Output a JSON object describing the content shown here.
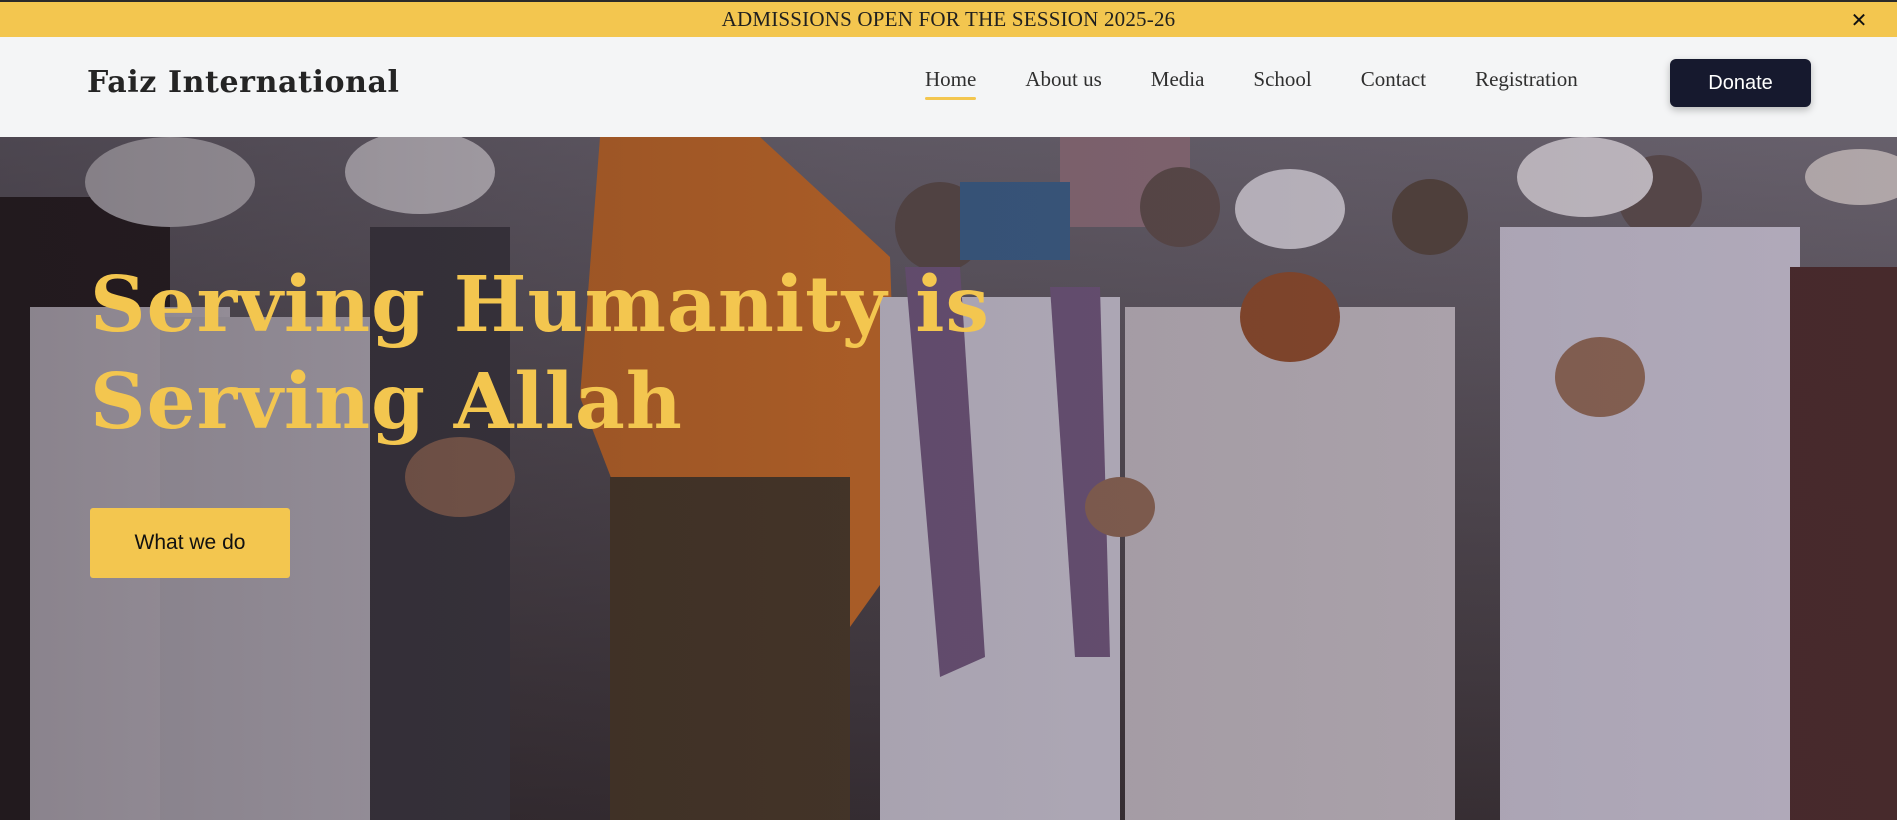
{
  "announcement": {
    "text": "ADMISSIONS OPEN FOR THE SESSION 2025-26",
    "close_icon": "close-icon"
  },
  "header": {
    "brand": "Faiz International",
    "nav": [
      {
        "label": "Home",
        "active": true
      },
      {
        "label": "About us",
        "active": false
      },
      {
        "label": "Media",
        "active": false
      },
      {
        "label": "School",
        "active": false
      },
      {
        "label": "Contact",
        "active": false
      },
      {
        "label": "Registration",
        "active": false
      }
    ],
    "donate_label": "Donate"
  },
  "hero": {
    "title_line1": "Serving Humanity is",
    "title_line2": "Serving Allah",
    "cta_label": "What we do"
  },
  "colors": {
    "accent": "#f3c64f",
    "dark_button": "#16192e",
    "header_bg": "#f4f5f6"
  }
}
